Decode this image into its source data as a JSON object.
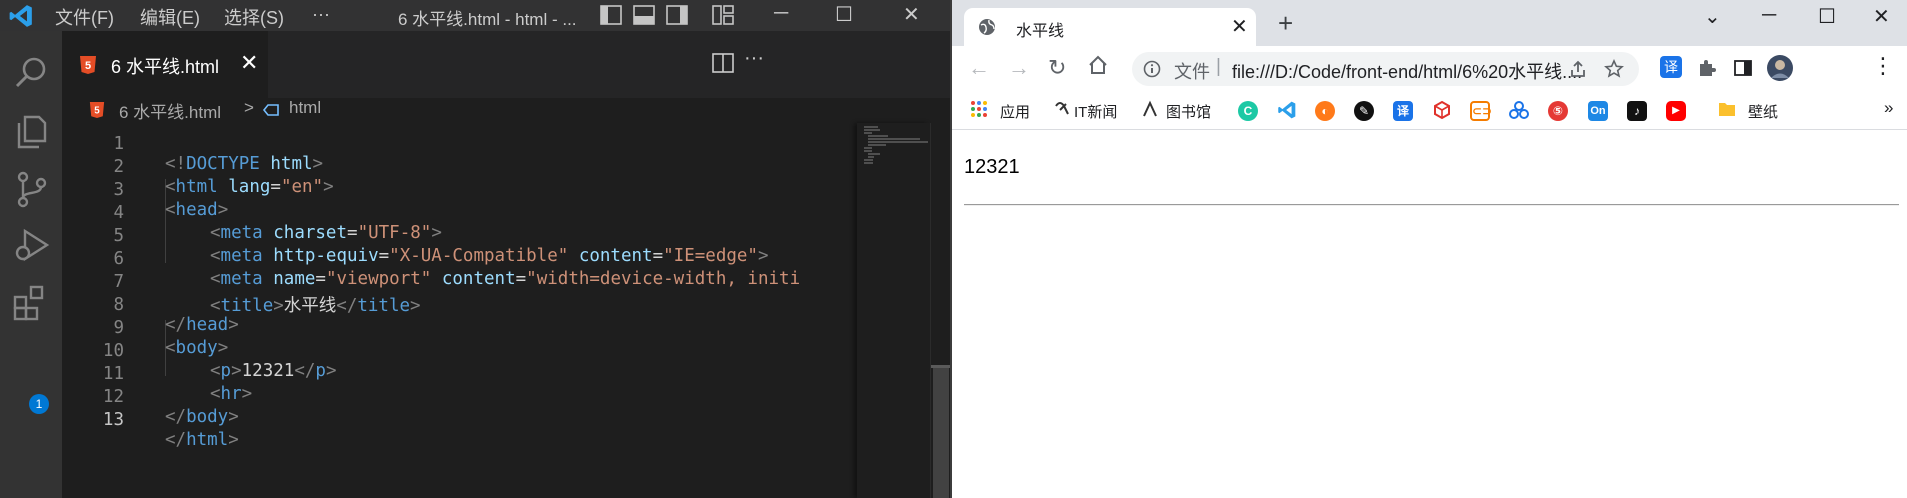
{
  "vscode": {
    "titlebar": {
      "menu": [
        "文件(F)",
        "编辑(E)",
        "选择(S)",
        "···"
      ],
      "title": "6 水平线.html - html - ..."
    },
    "activity": {
      "extensions_badge": "1"
    },
    "tab": {
      "label": "6 水平线.html"
    },
    "breadcrumb": {
      "file": "6 水平线.html",
      "separator": ">",
      "symbol": "html"
    },
    "editor": {
      "active_line": 13,
      "lines": [
        {
          "n": "1"
        },
        {
          "n": "2"
        },
        {
          "n": "3"
        },
        {
          "n": "4"
        },
        {
          "n": "5"
        },
        {
          "n": "6"
        },
        {
          "n": "7"
        },
        {
          "n": "8"
        },
        {
          "n": "9"
        },
        {
          "n": "10"
        },
        {
          "n": "11"
        },
        {
          "n": "12"
        },
        {
          "n": "13"
        }
      ],
      "code": {
        "l1": {
          "open": "<!",
          "kw": "DOCTYPE",
          "sp": " ",
          "attr": "html",
          "close": ">"
        },
        "l2": {
          "open": "<",
          "tag": "html",
          "sp": " ",
          "attr": "lang",
          "eq": "=",
          "val": "\"en\"",
          "close": ">"
        },
        "l3": {
          "open": "<",
          "tag": "head",
          "close": ">"
        },
        "l4": {
          "open": "<",
          "tag": "meta",
          "sp": " ",
          "attr": "charset",
          "eq": "=",
          "val": "\"UTF-8\"",
          "close": ">"
        },
        "l5": {
          "open": "<",
          "tag": "meta",
          "sp": " ",
          "attr1": "http-equiv",
          "eq1": "=",
          "val1": "\"X-UA-Compatible\"",
          "sp2": " ",
          "attr2": "content",
          "eq2": "=",
          "val2": "\"IE=edge\"",
          "close": ">"
        },
        "l6": {
          "open": "<",
          "tag": "meta",
          "sp": " ",
          "attr1": "name",
          "eq1": "=",
          "val1": "\"viewport\"",
          "sp2": " ",
          "attr2": "content",
          "eq2": "=",
          "val2": "\"width=device-width, initi"
        },
        "l7": {
          "open": "<",
          "tag": "title",
          "close": ">",
          "text": "水平线",
          "open2": "</",
          "tag2": "title",
          "close2": ">"
        },
        "l8": {
          "open": "</",
          "tag": "head",
          "close": ">"
        },
        "l9": {
          "open": "<",
          "tag": "body",
          "close": ">"
        },
        "l10": {
          "open": "<",
          "tag": "p",
          "close": ">",
          "text": "12321",
          "open2": "</",
          "tag2": "p",
          "close2": ">"
        },
        "l11": {
          "open": "<",
          "tag": "hr",
          "close": ">"
        },
        "l12": {
          "open": "</",
          "tag": "body",
          "close": ">"
        },
        "l13": {
          "open": "</",
          "tag": "html",
          "close": ">"
        }
      }
    }
  },
  "chrome": {
    "tab": {
      "title": "水平线"
    },
    "address": {
      "security_label": "文件",
      "separator": "|",
      "url": "file:///D:/Code/front-end/html/6%20水平线...."
    },
    "extension_translate": "译",
    "bookmarks": {
      "apps": "应用",
      "it_news": "IT新闻",
      "library": "图书馆",
      "translate": "译",
      "on": "On",
      "wallpaper": "壁纸",
      "more": "»"
    },
    "page": {
      "paragraph": "12321"
    }
  },
  "colors": {
    "vscode_bg": "#1e1e1e",
    "vscode_titlebar": "#323233",
    "vscode_activitybar": "#333333",
    "accent_blue": "#0078d4",
    "tag_color": "#569cd6",
    "attr_color": "#9cdcfe",
    "string_color": "#ce9178",
    "chrome_tabstrip": "#dee1e6"
  }
}
